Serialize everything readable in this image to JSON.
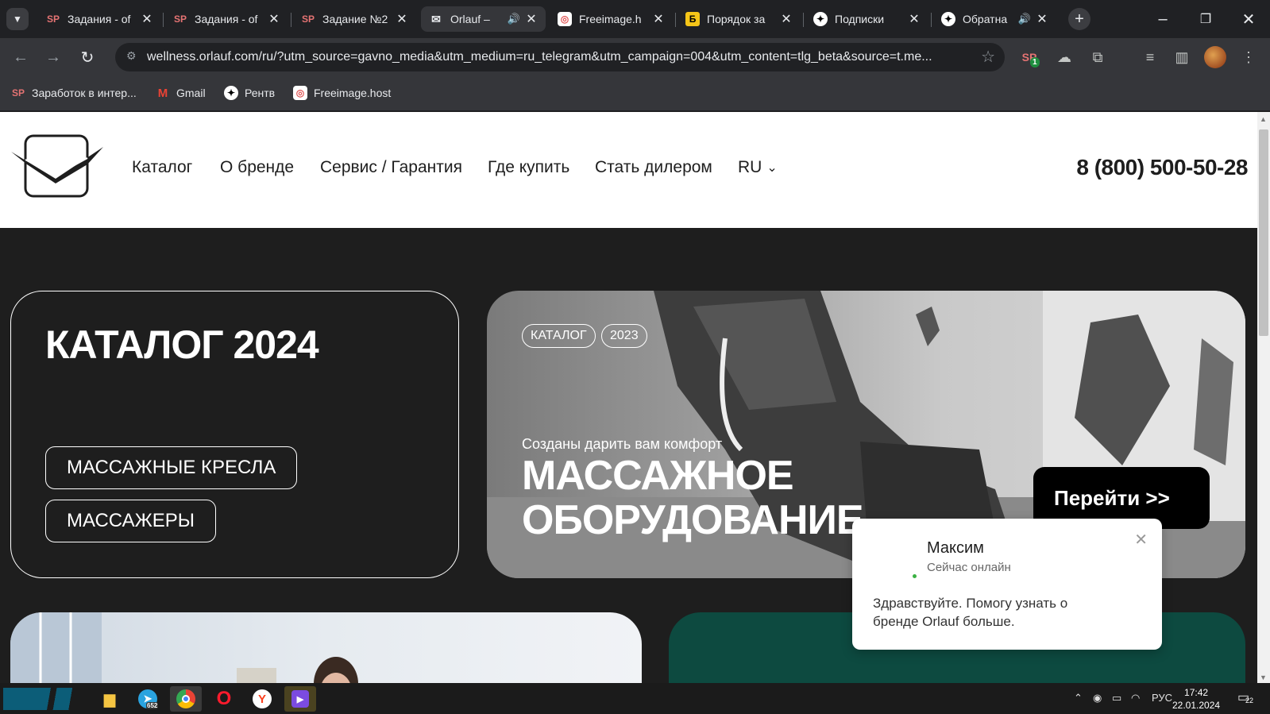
{
  "tabs": [
    {
      "title": "Задания - of",
      "icon": "sp-icon"
    },
    {
      "title": "Задания - of",
      "icon": "sp-icon"
    },
    {
      "title": "Задание №2",
      "icon": "sp-icon"
    },
    {
      "title": "Orlauf –",
      "icon": "orlauf-icon"
    },
    {
      "title": "Freeimage.h",
      "icon": "freeimage-icon"
    },
    {
      "title": "Порядок за",
      "icon": "b-icon"
    },
    {
      "title": "Подписки",
      "icon": "star-icon"
    },
    {
      "title": "Обратна",
      "icon": "star-icon"
    }
  ],
  "address": {
    "url": "wellness.orlauf.com/ru/?utm_source=gavno_media&utm_medium=ru_telegram&utm_campaign=004&utm_content=tlg_beta&source=t.me..."
  },
  "bookmarks": [
    {
      "label": "Заработок в интер..."
    },
    {
      "label": "Gmail"
    },
    {
      "label": "Рентв"
    },
    {
      "label": "Freeimage.host"
    }
  ],
  "extension_badge": "1",
  "site": {
    "nav": [
      "Каталог",
      "О бренде",
      "Сервис / Гарантия",
      "Где купить",
      "Стать дилером",
      "RU"
    ],
    "phone": "8 (800) 500-50-28"
  },
  "catalog": {
    "title": "КАТАЛОГ 2024",
    "buttons": [
      "МАССАЖНЫЕ КРЕСЛА",
      "МАССАЖЕРЫ"
    ]
  },
  "hero": {
    "tags": [
      "КАТАЛОГ",
      "2023"
    ],
    "subtitle": "Созданы дарить вам комфорт",
    "title_line1": "МАССАЖНОЕ",
    "title_line2": "ОБОРУДОВАНИЕ",
    "button": "Перейти >>"
  },
  "chat": {
    "name": "Максим",
    "status": "Сейчас онлайн",
    "message": "Здравствуйте. Помогу узнать о бренде Orlauf больше."
  },
  "taskbar": {
    "telegram_badge": "652",
    "lang": "РУС",
    "time": "17:42",
    "date": "22.01.2024",
    "notifications": "22"
  },
  "colors": {
    "chrome_dark": "#202124",
    "chrome_toolbar": "#35363a",
    "page_bg": "#1e1e1e",
    "accent_green": "#0d4a40"
  }
}
